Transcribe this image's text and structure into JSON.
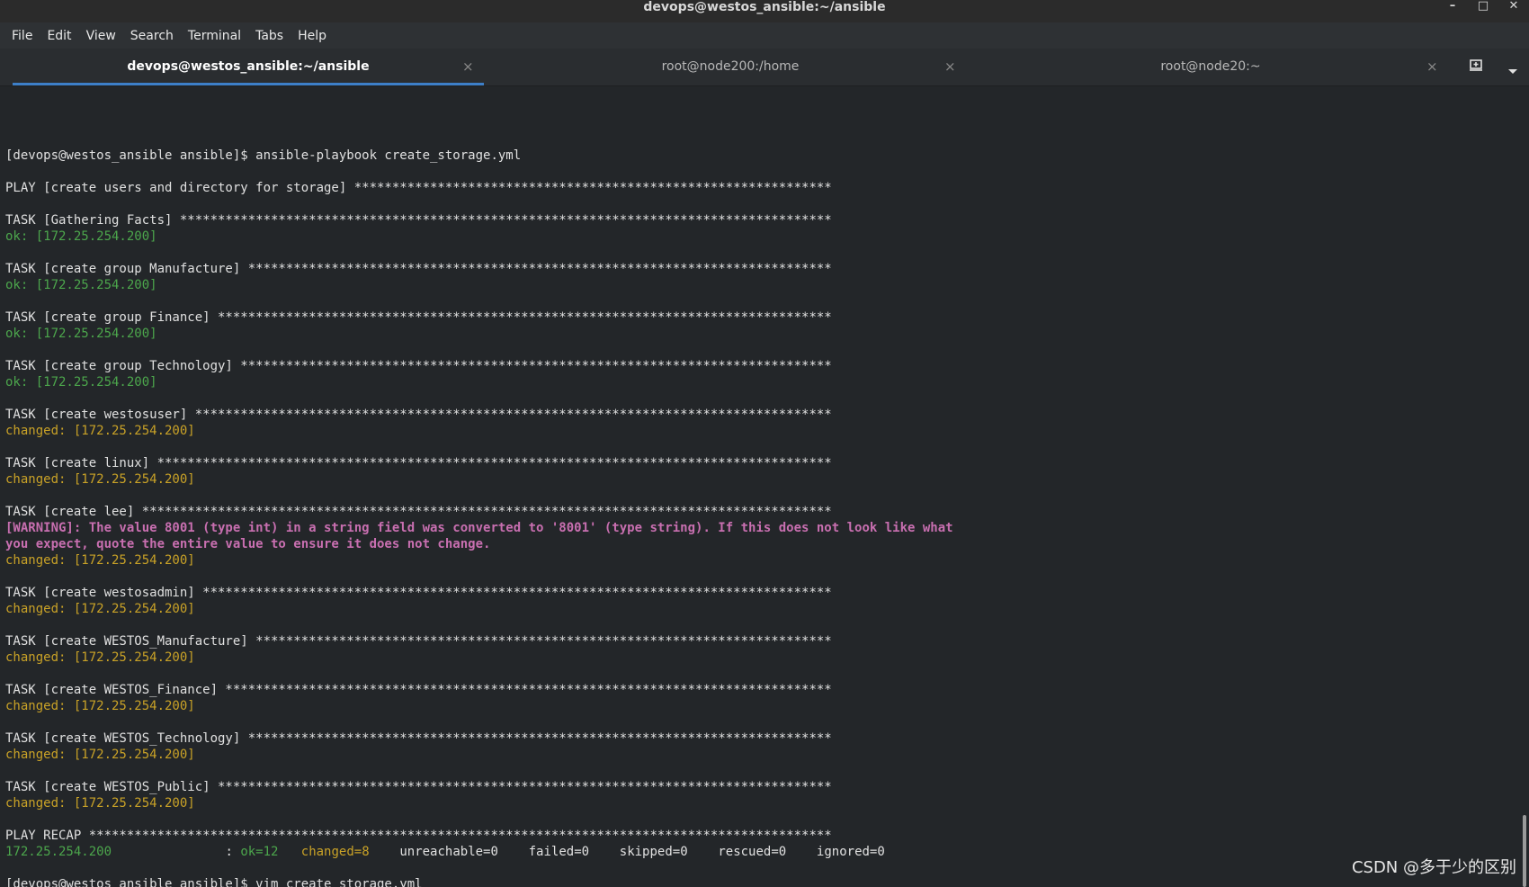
{
  "window": {
    "title": "devops@westos_ansible:~/ansible",
    "controls": {
      "minimize": "–",
      "maximize": "□",
      "close": "✕"
    }
  },
  "menu": [
    "File",
    "Edit",
    "View",
    "Search",
    "Terminal",
    "Tabs",
    "Help"
  ],
  "tabs": [
    {
      "label": "devops@westos_ansible:~/ansible",
      "active": true
    },
    {
      "label": "root@node200:/home",
      "active": false
    },
    {
      "label": "root@node20:~",
      "active": false
    }
  ],
  "tab_close": "×",
  "tab_icons": [
    "new-tab-icon",
    "chevron-down-icon"
  ],
  "colors": {
    "ok": "#4ca64c",
    "changed": "#c9a227",
    "warning": "#c86fb0",
    "active_tab": "#3d7fc8"
  },
  "terminal_lines": [
    {
      "text": "[devops@westos_ansible ansible]$ ansible-playbook create_storage.yml",
      "kind": "normal"
    },
    {
      "text": "",
      "kind": "normal"
    },
    {
      "text": "PLAY [create users and directory for storage] ***************************************************************",
      "kind": "normal"
    },
    {
      "text": "",
      "kind": "normal"
    },
    {
      "text": "TASK [Gathering Facts] **************************************************************************************",
      "kind": "normal"
    },
    {
      "text": "ok: [172.25.254.200]",
      "kind": "ok"
    },
    {
      "text": "",
      "kind": "normal"
    },
    {
      "text": "TASK [create group Manufacture] *****************************************************************************",
      "kind": "normal"
    },
    {
      "text": "ok: [172.25.254.200]",
      "kind": "ok"
    },
    {
      "text": "",
      "kind": "normal"
    },
    {
      "text": "TASK [create group Finance] *********************************************************************************",
      "kind": "normal"
    },
    {
      "text": "ok: [172.25.254.200]",
      "kind": "ok"
    },
    {
      "text": "",
      "kind": "normal"
    },
    {
      "text": "TASK [create group Technology] ******************************************************************************",
      "kind": "normal"
    },
    {
      "text": "ok: [172.25.254.200]",
      "kind": "ok"
    },
    {
      "text": "",
      "kind": "normal"
    },
    {
      "text": "TASK [create westosuser] ************************************************************************************",
      "kind": "normal"
    },
    {
      "text": "changed: [172.25.254.200]",
      "kind": "changed"
    },
    {
      "text": "",
      "kind": "normal"
    },
    {
      "text": "TASK [create linux] *****************************************************************************************",
      "kind": "normal"
    },
    {
      "text": "changed: [172.25.254.200]",
      "kind": "changed"
    },
    {
      "text": "",
      "kind": "normal"
    },
    {
      "text": "TASK [create lee] *******************************************************************************************",
      "kind": "normal"
    },
    {
      "text": "[WARNING]: The value 8001 (type int) in a string field was converted to '8001' (type string). If this does not look like what",
      "kind": "warn"
    },
    {
      "text": "you expect, quote the entire value to ensure it does not change.",
      "kind": "warn"
    },
    {
      "text": "changed: [172.25.254.200]",
      "kind": "changed"
    },
    {
      "text": "",
      "kind": "normal"
    },
    {
      "text": "TASK [create westosadmin] ***********************************************************************************",
      "kind": "normal"
    },
    {
      "text": "changed: [172.25.254.200]",
      "kind": "changed"
    },
    {
      "text": "",
      "kind": "normal"
    },
    {
      "text": "TASK [create WESTOS_Manufacture] ****************************************************************************",
      "kind": "normal"
    },
    {
      "text": "changed: [172.25.254.200]",
      "kind": "changed"
    },
    {
      "text": "",
      "kind": "normal"
    },
    {
      "text": "TASK [create WESTOS_Finance] ********************************************************************************",
      "kind": "normal"
    },
    {
      "text": "changed: [172.25.254.200]",
      "kind": "changed"
    },
    {
      "text": "",
      "kind": "normal"
    },
    {
      "text": "TASK [create WESTOS_Technology] *****************************************************************************",
      "kind": "normal"
    },
    {
      "text": "changed: [172.25.254.200]",
      "kind": "changed"
    },
    {
      "text": "",
      "kind": "normal"
    },
    {
      "text": "TASK [create WESTOS_Public] *********************************************************************************",
      "kind": "normal"
    },
    {
      "text": "changed: [172.25.254.200]",
      "kind": "changed"
    },
    {
      "text": "",
      "kind": "normal"
    },
    {
      "text": "PLAY RECAP **************************************************************************************************",
      "kind": "normal"
    },
    {
      "text": "",
      "kind": "recap"
    },
    {
      "text": "",
      "kind": "normal"
    },
    {
      "text": "[devops@westos_ansible ansible]$ vim create_storage.yml",
      "kind": "normal"
    }
  ],
  "recap": {
    "host": "172.25.254.200",
    "sep": "               : ",
    "ok": "ok=12",
    "changed": "changed=8",
    "rest": "    unreachable=0    failed=0    skipped=0    rescued=0    ignored=0"
  },
  "watermark": "CSDN @多于少的区别"
}
